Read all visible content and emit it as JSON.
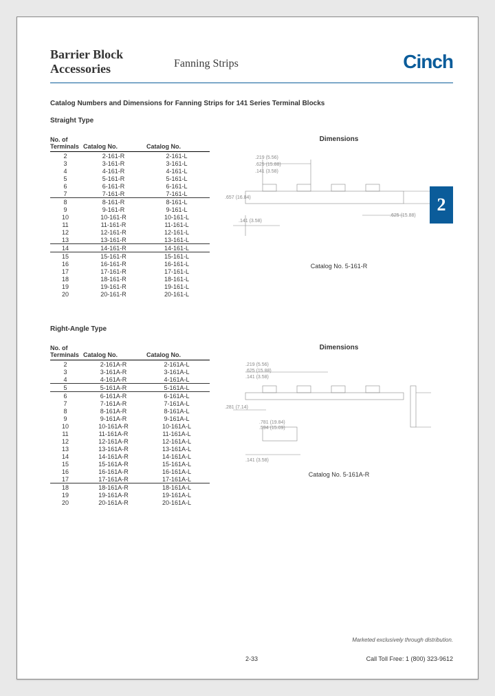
{
  "header": {
    "title_line1": "Barrier Block",
    "title_line2": "Accessories",
    "subtitle": "Fanning Strips",
    "brand": "Cinch"
  },
  "sectionTab": "2",
  "catalog_heading": "Catalog Numbers and Dimensions for Fanning Strips for 141 Series Terminal Blocks",
  "t1": {
    "subtitle": "Straight Type",
    "dims_title": "Dimensions",
    "col1": "No. of\nTerminals",
    "col2": "Catalog No.",
    "col3": "Catalog No.",
    "rows": [
      {
        "n": "2",
        "r": "2-161-R",
        "l": "2-161-L"
      },
      {
        "n": "3",
        "r": "3-161-R",
        "l": "3-161-L"
      },
      {
        "n": "4",
        "r": "4-161-R",
        "l": "4-161-L"
      },
      {
        "n": "5",
        "r": "5-161-R",
        "l": "5-161-L"
      },
      {
        "n": "6",
        "r": "6-161-R",
        "l": "6-161-L"
      },
      {
        "n": "7",
        "r": "7-161-R",
        "l": "7-161-L",
        "u": true
      },
      {
        "n": "8",
        "r": "8-161-R",
        "l": "8-161-L"
      },
      {
        "n": "9",
        "r": "9-161-R",
        "l": "9-161-L"
      },
      {
        "n": "10",
        "r": "10-161-R",
        "l": "10-161-L"
      },
      {
        "n": "11",
        "r": "11-161-R",
        "l": "11-161-L"
      },
      {
        "n": "12",
        "r": "12-161-R",
        "l": "12-161-L"
      },
      {
        "n": "13",
        "r": "13-161-R",
        "l": "13-161-L",
        "u": true
      },
      {
        "n": "14",
        "r": "14-161-R",
        "l": "14-161-L",
        "u": true
      },
      {
        "n": "15",
        "r": "15-161-R",
        "l": "15-161-L"
      },
      {
        "n": "16",
        "r": "16-161-R",
        "l": "16-161-L"
      },
      {
        "n": "17",
        "r": "17-161-R",
        "l": "17-161-L"
      },
      {
        "n": "18",
        "r": "18-161-R",
        "l": "18-161-L"
      },
      {
        "n": "19",
        "r": "19-161-R",
        "l": "19-161-L"
      },
      {
        "n": "20",
        "r": "20-161-R",
        "l": "20-161-L"
      }
    ],
    "caption": "Catalog No. 5-161-R",
    "dim_a": ".219 (5.56)",
    "dim_b": ".625 (15.88)",
    "dim_c": ".141 (3.58)",
    "dim_d": ".657 (16.84)",
    "dim_e": ".141 (3.58)",
    "dim_f": ".625 (15.88)"
  },
  "t2": {
    "subtitle": "Right-Angle Type",
    "dims_title": "Dimensions",
    "col1": "No. of\nTerminals",
    "col2": "Catalog No.",
    "col3": "Catalog No.",
    "rows": [
      {
        "n": "2",
        "r": "2-161A-R",
        "l": "2-161A-L"
      },
      {
        "n": "3",
        "r": "3-161A-R",
        "l": "3-161A-L"
      },
      {
        "n": "4",
        "r": "4-161A-R",
        "l": "4-161A-L",
        "u": true
      },
      {
        "n": "5",
        "r": "5-161A-R",
        "l": "5-161A-L",
        "u": true
      },
      {
        "n": "6",
        "r": "6-161A-R",
        "l": "6-161A-L"
      },
      {
        "n": "7",
        "r": "7-161A-R",
        "l": "7-161A-L"
      },
      {
        "n": "8",
        "r": "8-161A-R",
        "l": "8-161A-L"
      },
      {
        "n": "9",
        "r": "9-161A-R",
        "l": "9-161A-L"
      },
      {
        "n": "10",
        "r": "10-161A-R",
        "l": "10-161A-L"
      },
      {
        "n": "11",
        "r": "11-161A-R",
        "l": "11-161A-L"
      },
      {
        "n": "12",
        "r": "12-161A-R",
        "l": "12-161A-L"
      },
      {
        "n": "13",
        "r": "13-161A-R",
        "l": "13-161A-L"
      },
      {
        "n": "14",
        "r": "14-161A-R",
        "l": "14-161A-L"
      },
      {
        "n": "15",
        "r": "15-161A-R",
        "l": "15-161A-L"
      },
      {
        "n": "16",
        "r": "16-161A-R",
        "l": "16-161A-L"
      },
      {
        "n": "17",
        "r": "17-161A-R",
        "l": "17-161A-L",
        "u": true
      },
      {
        "n": "18",
        "r": "18-161A-R",
        "l": "18-161A-L"
      },
      {
        "n": "19",
        "r": "19-161A-R",
        "l": "19-161A-L"
      },
      {
        "n": "20",
        "r": "20-161A-R",
        "l": "20-161A-L"
      }
    ],
    "caption": "Catalog No. 5-161A-R",
    "dim_a": ".219 (5.56)",
    "dim_b": ".625 (15.88)",
    "dim_c": ".141 (3.58)",
    "dim_d": ".281 (7.14)",
    "dim_e": ".781 (19.84)",
    "dim_f": ".594 (15.09)",
    "dim_g": ".141 (3.58)"
  },
  "footer": {
    "page": "2-33",
    "phone": "Call Toll Free:  1 (800) 323-9612",
    "distro": "Marketed exclusively through distribution."
  }
}
